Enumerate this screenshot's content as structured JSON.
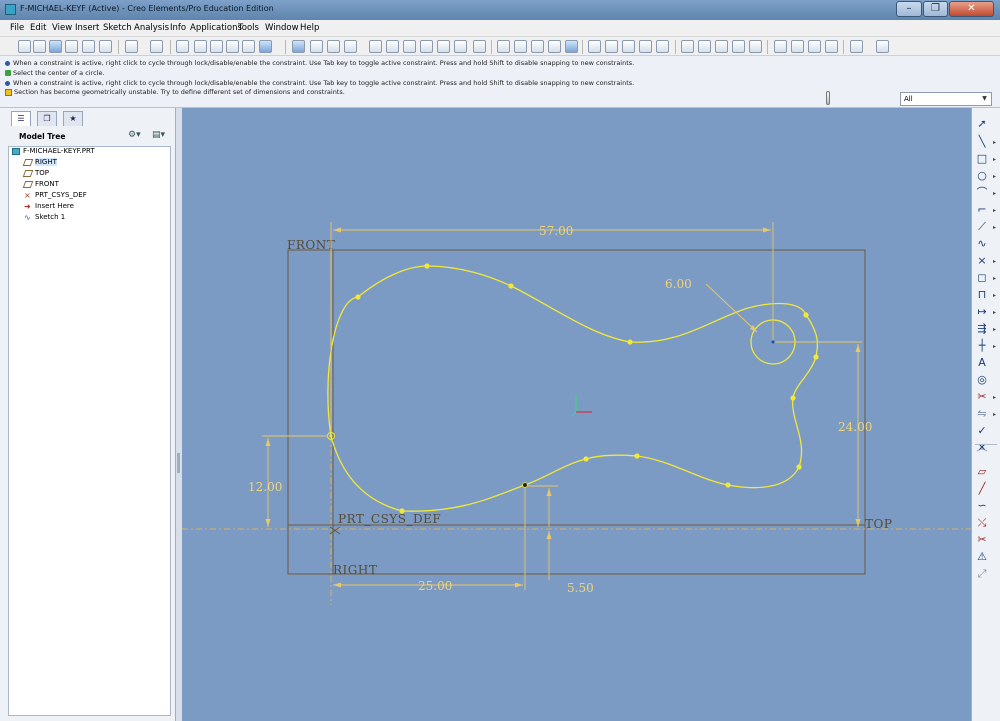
{
  "window": {
    "title": "F-MICHAEL-KEYF (Active) - Creo Elements/Pro Education Edition",
    "controls": [
      "–",
      "❐",
      "✕"
    ]
  },
  "menu": {
    "items": [
      "File",
      "Edit",
      "View",
      "Insert",
      "Sketch",
      "Analysis",
      "Info",
      "Applications",
      "Tools",
      "Window",
      "Help"
    ]
  },
  "messages": [
    {
      "icon": "bullet",
      "text": "When a constraint is active, right click to cycle through lock/disable/enable the constraint. Use Tab key to toggle active constraint. Press and hold Shift to disable snapping to new constraints."
    },
    {
      "icon": "arrow",
      "text": "Select the center of a circle."
    },
    {
      "icon": "bullet",
      "text": "When a constraint is active, right click to cycle through lock/disable/enable the constraint. Use Tab key to toggle active constraint. Press and hold Shift to disable snapping to new constraints."
    },
    {
      "icon": "warning",
      "text": "Section has become geometrically unstable. Try to define different set of dimensions and constraints."
    }
  ],
  "filter": {
    "value": "All"
  },
  "model_tree": {
    "title": "Model Tree",
    "items": [
      {
        "label": "F-MICHAEL-KEYF.PRT",
        "icon": "part-icon",
        "indent": 0
      },
      {
        "label": "RIGHT",
        "icon": "datum-plane-icon",
        "indent": 1,
        "selected": true
      },
      {
        "label": "TOP",
        "icon": "datum-plane-icon",
        "indent": 1
      },
      {
        "label": "FRONT",
        "icon": "datum-plane-icon",
        "indent": 1
      },
      {
        "label": "PRT_CSYS_DEF",
        "icon": "csys-icon",
        "indent": 1
      },
      {
        "label": "Insert Here",
        "icon": "insert-arrow-icon",
        "indent": 1
      },
      {
        "label": "Sketch 1",
        "icon": "sketch-icon",
        "indent": 1
      }
    ]
  },
  "sketch": {
    "datum_labels": {
      "front": "FRONT",
      "right": "RIGHT",
      "top": "TOP",
      "csys": "PRT_CSYS_DEF"
    },
    "dimensions": {
      "top_width": "57.00",
      "radius": "6.00",
      "right_height": "24.00",
      "left_height": "12.00",
      "bottom_width": "25.00",
      "bottom_offset": "5.50"
    }
  },
  "colors": {
    "background": "#7c9bc4",
    "spline": "#f2e838",
    "dimension": "#f0d474",
    "datum": "#6b5a3c"
  }
}
